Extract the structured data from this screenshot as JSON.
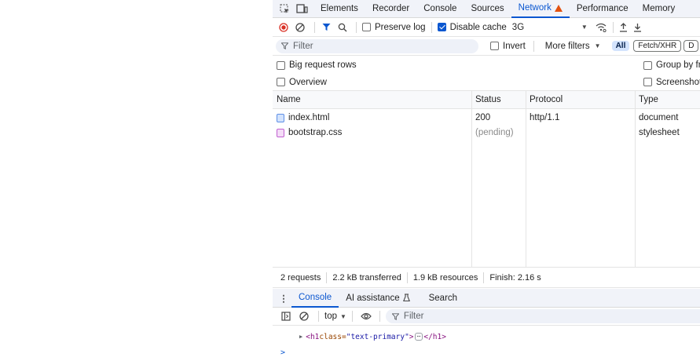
{
  "tabs": {
    "items": [
      "Elements",
      "Recorder",
      "Console",
      "Sources",
      "Network",
      "Performance",
      "Memory"
    ],
    "active": "Network"
  },
  "toolbar": {
    "preserve_log": "Preserve log",
    "disable_cache": "Disable cache",
    "throttling": "3G"
  },
  "filter": {
    "placeholder": "Filter",
    "invert": "Invert",
    "more_filters": "More filters",
    "type_all": "All",
    "type_fetch": "Fetch/XHR",
    "type_doc": "D"
  },
  "options": {
    "big_request_rows": "Big request rows",
    "overview": "Overview",
    "group_by": "Group by fr",
    "screenshots": "Screenshot"
  },
  "table": {
    "headers": {
      "name": "Name",
      "status": "Status",
      "protocol": "Protocol",
      "type": "Type"
    },
    "rows": [
      {
        "name": "index.html",
        "status": "200",
        "protocol": "http/1.1",
        "type": "document",
        "icon": "document-icon"
      },
      {
        "name": "bootstrap.css",
        "status": "(pending)",
        "protocol": "",
        "type": "stylesheet",
        "icon": "stylesheet-icon"
      }
    ]
  },
  "summary": {
    "requests": "2 requests",
    "transferred": "2.2 kB transferred",
    "resources": "1.9 kB resources",
    "finish": "Finish: 2.16 s"
  },
  "drawer": {
    "tabs": [
      "Console",
      "AI assistance",
      "Search"
    ],
    "active": "Console",
    "context": "top",
    "filter": "Filter"
  },
  "console": {
    "tag_open": "<h1",
    "attr_name": " class=",
    "attr_value": "\"text-primary\"",
    "tag_close_open": ">",
    "tag_end": "</h1>",
    "prompt": ">"
  },
  "colors": {
    "accent": "#0b57d0",
    "warning": "#e2510f",
    "record": "#d93025"
  }
}
